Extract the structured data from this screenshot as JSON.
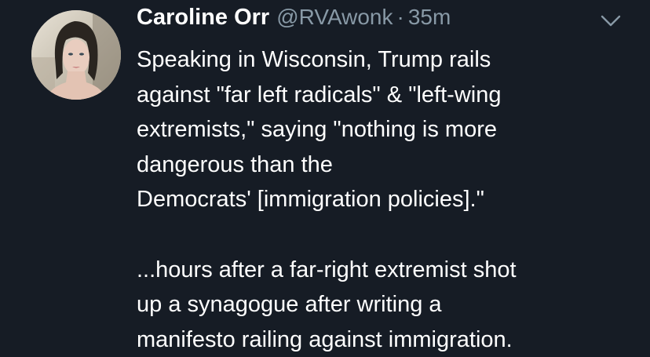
{
  "tweet": {
    "author": {
      "display_name": "Caroline Orr",
      "handle": "@RVAwonk",
      "avatar_icon": "profile-photo"
    },
    "separator": "·",
    "timestamp": "35m",
    "menu_icon": "chevron-down-icon",
    "text": {
      "paragraph1": [
        "Speaking in Wisconsin, Trump rails",
        "against \"far left radicals\" & \"left-wing",
        "extremists,\" saying \"nothing is more",
        "dangerous than the",
        "Democrats' [immigration policies].\""
      ],
      "paragraph2": [
        "...hours after a far-right extremist shot",
        "up a synagogue after writing a",
        "manifesto railing against immigration."
      ]
    }
  },
  "colors": {
    "background": "#161c25",
    "primary_text": "#ffffff",
    "secondary_text": "#8899a6"
  }
}
